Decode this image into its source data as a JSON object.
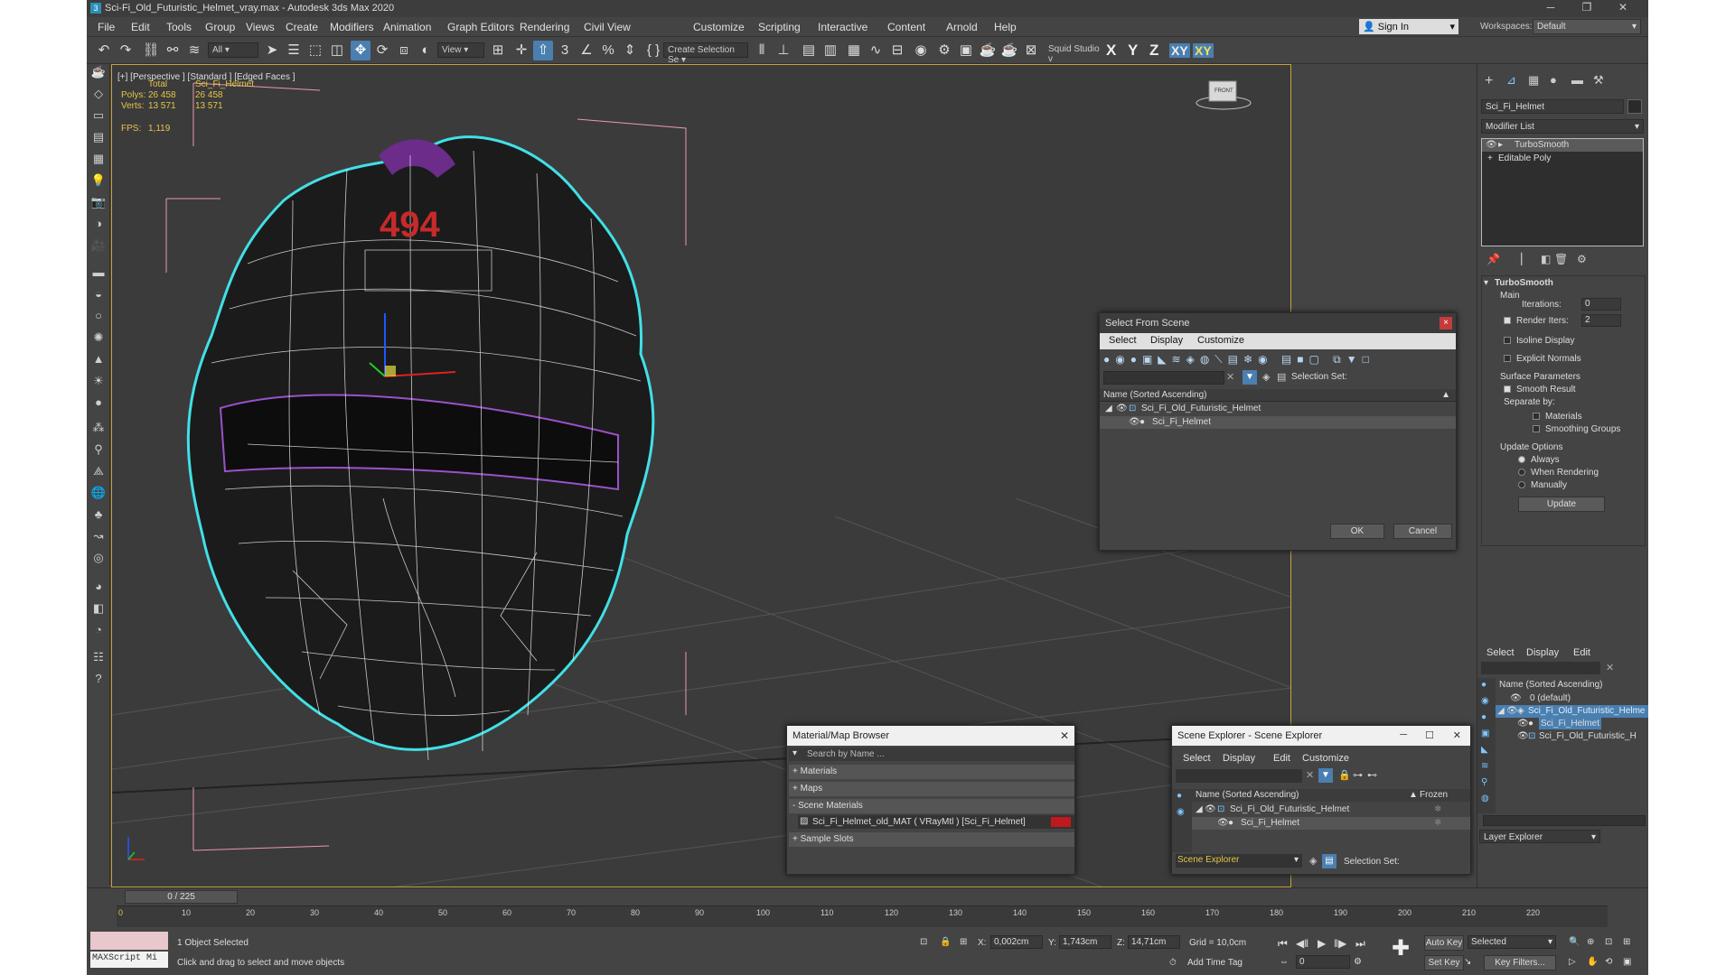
{
  "window": {
    "title": "Sci-Fi_Old_Futuristic_Helmet_vray.max - Autodesk 3ds Max 2020"
  },
  "menu": [
    "File",
    "Edit",
    "Tools",
    "Group",
    "Views",
    "Create",
    "Modifiers",
    "Animation",
    "Graph Editors",
    "Rendering",
    "Civil View",
    "Customize",
    "Scripting",
    "Interactive",
    "Content",
    "Arnold",
    "Help"
  ],
  "account": {
    "sign_in": "Sign In",
    "workspace_label": "Workspaces:",
    "workspace_value": "Default"
  },
  "toolbar": {
    "filter": "All",
    "ref_coord": "View",
    "selection_set": "Create Selection Se",
    "studio": "Squid Studio v",
    "axes": [
      "X",
      "Y",
      "Z",
      "XY",
      "XY"
    ]
  },
  "viewport": {
    "label": "[+] [Perspective ] [Standard ] [Edged Faces ]",
    "stats": {
      "total_label": "Total",
      "object_label": "Sci_Fi_Helmet",
      "polys_label": "Polys:",
      "polys_total": "26 458",
      "polys_obj": "26 458",
      "verts_label": "Verts:",
      "verts_total": "13 571",
      "verts_obj": "13 571",
      "fps_label": "FPS:",
      "fps": "1,119"
    },
    "viewcube": "FRONT"
  },
  "modify_panel": {
    "object_name": "Sci_Fi_Helmet",
    "modifier_list": "Modifier List",
    "stack": [
      "TurboSmooth",
      "Editable Poly"
    ],
    "rollout_title": "TurboSmooth",
    "main_label": "Main",
    "iterations_label": "Iterations:",
    "iterations": "0",
    "render_iters_label": "Render Iters:",
    "render_iters": "2",
    "isoline": "Isoline Display",
    "explicit_normals": "Explicit Normals",
    "surface_params": "Surface Parameters",
    "smooth_result": "Smooth Result",
    "separate_by": "Separate by:",
    "materials": "Materials",
    "smoothing_groups": "Smoothing Groups",
    "update_options": "Update Options",
    "always": "Always",
    "when_rendering": "When Rendering",
    "manually": "Manually",
    "update_btn": "Update"
  },
  "select_from_scene": {
    "title": "Select From Scene",
    "tabs": [
      "Select",
      "Display",
      "Customize"
    ],
    "selection_set": "Selection Set:",
    "column": "Name (Sorted Ascending)",
    "items": [
      "Sci_Fi_Old_Futuristic_Helmet",
      "Sci_Fi_Helmet"
    ],
    "ok": "OK",
    "cancel": "Cancel"
  },
  "layer_explorer": {
    "tabs": [
      "Select",
      "Display",
      "Edit"
    ],
    "column": "Name (Sorted Ascending)",
    "items": [
      "0 (default)",
      "Sci_Fi_Old_Futuristic_Helme",
      "Sci_Fi_Helmet",
      "Sci_Fi_Old_Futuristic_H"
    ],
    "footer": "Layer Explorer"
  },
  "material_browser": {
    "title": "Material/Map Browser",
    "search": "Search by Name ...",
    "groups": [
      "+ Materials",
      "+ Maps",
      "- Scene Materials",
      "+ Sample Slots"
    ],
    "material": "Sci_Fi_Helmet_old_MAT ( VRayMtl ) [Sci_Fi_Helmet]"
  },
  "scene_explorer": {
    "title": "Scene Explorer - Scene Explorer",
    "tabs": [
      "Select",
      "Display",
      "Edit",
      "Customize"
    ],
    "column": "Name (Sorted Ascending)",
    "frozen": "Frozen",
    "items": [
      "Sci_Fi_Old_Futuristic_Helmet",
      "Sci_Fi_Helmet"
    ],
    "footer_name": "Scene Explorer",
    "selection_set": "Selection Set:"
  },
  "timeline": {
    "frame": "0 / 225",
    "ticks": [
      "0",
      "10",
      "20",
      "30",
      "40",
      "50",
      "60",
      "70",
      "80",
      "90",
      "100",
      "110",
      "120",
      "130",
      "140",
      "150",
      "160",
      "170",
      "180",
      "190",
      "200",
      "210",
      "220"
    ]
  },
  "status": {
    "maxscript": "MAXScript Mi",
    "selected": "1 Object Selected",
    "prompt": "Click and drag to select and move objects",
    "x_label": "X:",
    "x": "0,002cm",
    "y_label": "Y:",
    "y": "1,743cm",
    "z_label": "Z:",
    "z": "14,71cm",
    "grid": "Grid = 10,0cm",
    "add_time_tag": "Add Time Tag",
    "auto_key": "Auto Key",
    "set_key": "Set Key",
    "key_mode": "Selected",
    "key_filters": "Key Filters...",
    "frame": "0"
  },
  "colors": {
    "accent": "#4a7fb0",
    "selection": "#41e0e6",
    "viewport_border": "#c8a23c",
    "stat_text": "#e6c547"
  }
}
